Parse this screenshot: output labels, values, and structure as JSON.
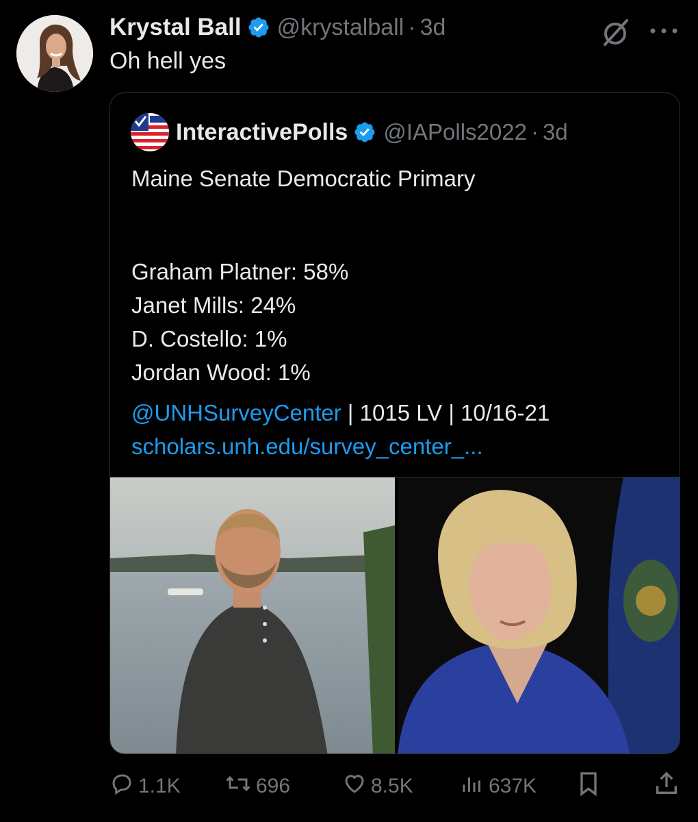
{
  "tweet": {
    "author_name": "Krystal Ball",
    "handle": "@krystalball",
    "separator": "·",
    "time": "3d",
    "text": "Oh hell yes"
  },
  "quoted_tweet": {
    "author_name": "InteractivePolls",
    "handle": "@IAPolls2022",
    "separator": "·",
    "time": "3d",
    "lines": {
      "title": "Maine Senate Democratic Primary",
      "result_1": "Graham Platner: 58%",
      "result_2": "Janet Mills: 24%",
      "result_3": "D. Costello: 1%",
      "result_4": "Jordan Wood: 1%",
      "source_mention": "@UNHSurveyCenter",
      "source_details": " | 1015 LV | 10/16-21",
      "link": "scholars.unh.edu/survey_center_..."
    }
  },
  "actions": {
    "replies": "1.1K",
    "reposts": "696",
    "likes": "8.5K",
    "views": "637K"
  },
  "colors": {
    "background": "#000000",
    "text": "#e7e9ea",
    "muted": "#71767b",
    "link": "#1d9bf0",
    "verified": "#1d9bf0",
    "border": "#2f3336"
  },
  "icons": [
    "verified-badge-icon",
    "grok-icon",
    "more-icon",
    "reply-icon",
    "repost-icon",
    "like-icon",
    "views-icon",
    "bookmark-icon",
    "share-icon"
  ]
}
